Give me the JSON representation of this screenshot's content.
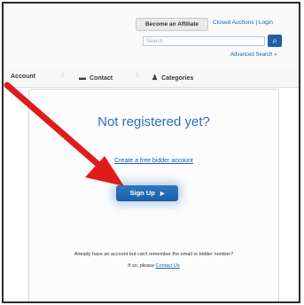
{
  "header": {
    "become_affiliate": "Become an Affiliate",
    "top_links": "Closed Auctions | Login",
    "search_placeholder": "Search",
    "advanced_search": "Advanced Search »"
  },
  "nav": {
    "account": "Account",
    "contact": "Contact",
    "categories": "Categories",
    "separator": "|"
  },
  "panel": {
    "heading": "Not registered yet?",
    "create_link": "Create a free bidder account",
    "signup_label": "Sign Up",
    "already_text": "Already have an account but can't remember the email or bidder number?",
    "please_prefix": "If so, please",
    "contact_us": "Contact Us"
  },
  "icons": {
    "search": "search-icon",
    "contact": "chat-icon",
    "categories": "people-icon",
    "signup_arrow": "play-arrow-icon",
    "annotation": "red-arrow"
  },
  "colors": {
    "accent": "#2e6fc2",
    "button": "#1f5fa2",
    "annotation": "#e01b1b"
  }
}
